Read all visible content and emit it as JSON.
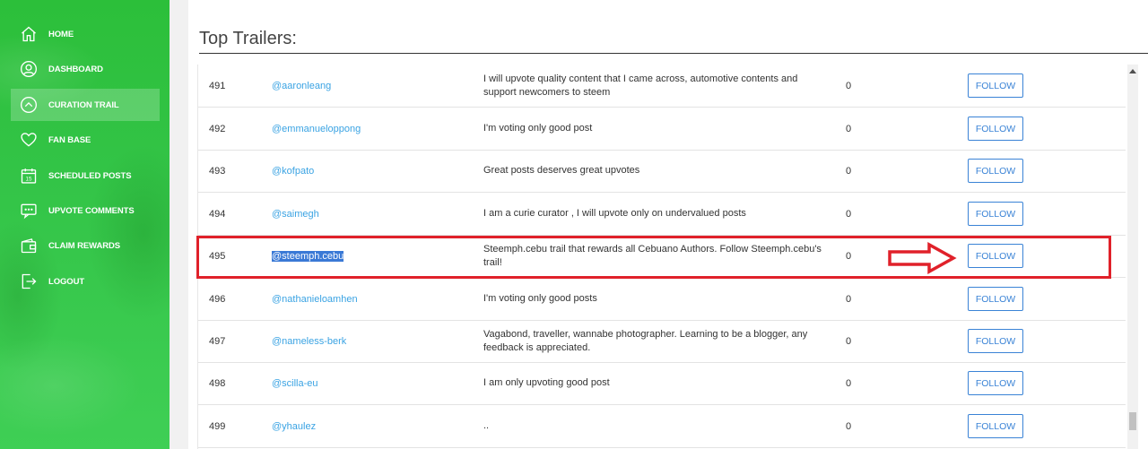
{
  "sidebar": {
    "items": [
      {
        "label": "HOME",
        "icon": "home-icon"
      },
      {
        "label": "DASHBOARD",
        "icon": "user-icon"
      },
      {
        "label": "CURATION TRAIL",
        "icon": "chevron-up-circle-icon",
        "active": true
      },
      {
        "label": "FAN BASE",
        "icon": "heart-icon"
      },
      {
        "label": "SCHEDULED POSTS",
        "icon": "calendar-icon",
        "calendar_day": "15"
      },
      {
        "label": "UPVOTE COMMENTS",
        "icon": "comment-icon"
      },
      {
        "label": "CLAIM REWARDS",
        "icon": "wallet-icon"
      },
      {
        "label": "LOGOUT",
        "icon": "logout-icon"
      }
    ]
  },
  "main": {
    "title": "Top Trailers:",
    "follow_label": "FOLLOW",
    "rows": [
      {
        "rank": "491",
        "user": "@aaronleang",
        "description": "I will upvote quality content that I came across, automotive contents and support newcomers to steem",
        "count": "0"
      },
      {
        "rank": "492",
        "user": "@emmanueloppong",
        "description": "I'm voting only good post",
        "count": "0"
      },
      {
        "rank": "493",
        "user": "@kofpato",
        "description": "Great posts deserves great upvotes",
        "count": "0"
      },
      {
        "rank": "494",
        "user": "@saimegh",
        "description": "I am a curie curator , I will upvote only on undervalued posts",
        "count": "0"
      },
      {
        "rank": "495",
        "user": "@steemph.cebu",
        "description": "Steemph.cebu trail that rewards all Cebuano Authors. Follow Steemph.cebu's trail!",
        "count": "0"
      },
      {
        "rank": "496",
        "user": "@nathanieloamhen",
        "description": "I'm voting only good posts",
        "count": "0"
      },
      {
        "rank": "497",
        "user": "@nameless-berk",
        "description": "Vagabond, traveller, wannabe photographer. Learning to be a blogger, any feedback is appreciated.",
        "count": "0"
      },
      {
        "rank": "498",
        "user": "@scilla-eu",
        "description": "I am only upvoting good post",
        "count": "0"
      },
      {
        "rank": "499",
        "user": "@yhaulez",
        "description": "..",
        "count": "0"
      }
    ]
  },
  "colors": {
    "sidebar_green": "#33c447",
    "link_blue": "#3aa3e3",
    "button_blue": "#3a83d6",
    "annotation_red": "#e0212a"
  }
}
